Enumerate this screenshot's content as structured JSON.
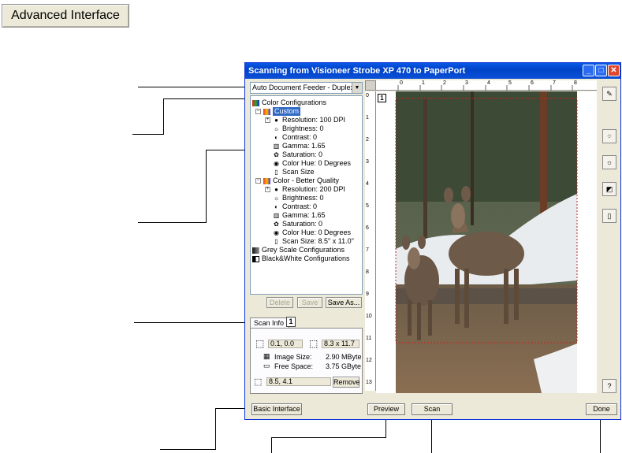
{
  "top_button": {
    "label": "Advanced Interface"
  },
  "window": {
    "title": "Scanning from Visioneer Strobe XP 470 to PaperPort",
    "controls": {
      "minimize": "_",
      "maximize": "□",
      "close": "✕"
    }
  },
  "source": {
    "value": "Auto Document Feeder - Duplex"
  },
  "tree": {
    "color_root": "Color Configurations",
    "custom": "Custom",
    "custom_items": [
      "Resolution: 100 DPI",
      "Brightness: 0",
      "Contrast: 0",
      "Gamma: 1.65",
      "Saturation: 0",
      "Color Hue: 0 Degrees",
      "Scan Size"
    ],
    "better": "Color - Better Quality",
    "better_items": [
      "Resolution: 200 DPI",
      "Brightness: 0",
      "Contrast: 0",
      "Gamma: 1.65",
      "Saturation: 0",
      "Color Hue: 0 Degrees",
      "Scan Size: 8.5\" x 11.0\""
    ],
    "grey": "Grey Scale Configurations",
    "bw": "Black&White Configurations"
  },
  "tree_buttons": {
    "delete": "Delete",
    "save": "Save",
    "save_as": "Save As..."
  },
  "scan_info": {
    "tab": "Scan Info",
    "tab_number": "1",
    "origin": "0.1, 0.0",
    "size": "8.3 x 11.7",
    "image_size_label": "Image Size:",
    "image_size_value": "2.90 MByte",
    "free_space_label": "Free Space:",
    "free_space_value": "3.75 GByte",
    "position": "8.5, 4.1",
    "remove": "Remove"
  },
  "ruler": {
    "h_numbers": [
      "0",
      "1",
      "2",
      "3",
      "4",
      "5",
      "6",
      "7",
      "8"
    ],
    "v_numbers": [
      "0",
      "1",
      "2",
      "3",
      "4",
      "5",
      "6",
      "7",
      "8",
      "9",
      "10",
      "11",
      "12",
      "13"
    ]
  },
  "preview": {
    "page_marker": "1"
  },
  "bottom_buttons": {
    "basic": "Basic Interface",
    "preview": "Preview",
    "scan": "Scan",
    "done": "Done"
  },
  "colors": {
    "title_bar": "#0a4fd6",
    "selection": "#316ac5",
    "window_bg": "#ece9d8",
    "scan_area_border": "#cc2222"
  }
}
